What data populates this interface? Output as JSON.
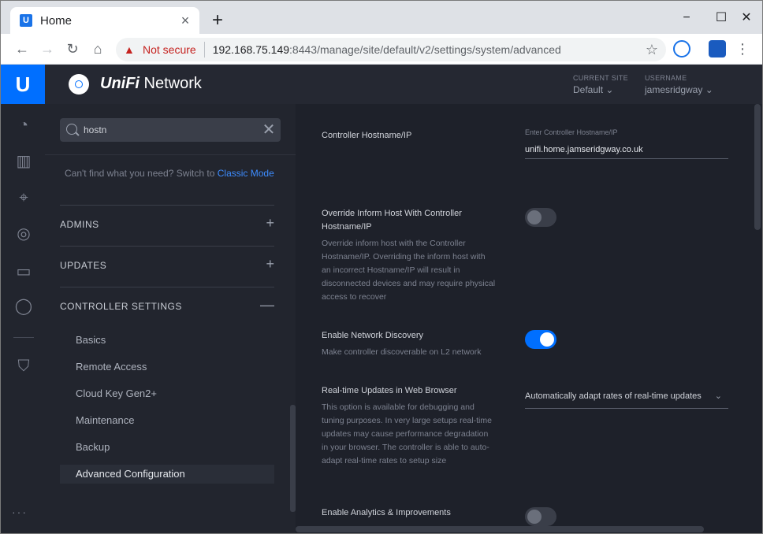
{
  "browser": {
    "tab_title": "Home",
    "tab_favicon": "U",
    "not_secure": "Not secure",
    "url_host": "192.168.75.149",
    "url_rest": ":8443/manage/site/default/v2/settings/system/advanced"
  },
  "header": {
    "brand_prefix": "UniFi",
    "brand_suffix": " Network",
    "current_site_label": "CURRENT SITE",
    "current_site_value": "Default",
    "username_label": "USERNAME",
    "username_value": "jamesridgway"
  },
  "sidebar": {
    "search_value": "hostn",
    "hint_text": "Can't find what you need? Switch to ",
    "hint_link": "Classic Mode",
    "sections": [
      {
        "label": "ADMINS",
        "toggle": "+"
      },
      {
        "label": "UPDATES",
        "toggle": "+"
      },
      {
        "label": "CONTROLLER SETTINGS",
        "toggle": "—"
      }
    ],
    "items": [
      {
        "label": "Basics"
      },
      {
        "label": "Remote Access"
      },
      {
        "label": "Cloud Key Gen2+"
      },
      {
        "label": "Maintenance"
      },
      {
        "label": "Backup"
      },
      {
        "label": "Advanced Configuration"
      }
    ]
  },
  "content": {
    "hostname_title": "Controller Hostname/IP",
    "hostname_field_label": "Enter Controller Hostname/IP",
    "hostname_value": "unifi.home.jamseridgway.co.uk",
    "override_title": "Override Inform Host With Controller Hostname/IP",
    "override_desc": "Override inform host with the Controller Hostname/IP. Overriding the inform host with an incorrect Hostname/IP will result in disconnected devices and may require physical access to recover",
    "override_on": false,
    "discovery_title": "Enable Network Discovery",
    "discovery_desc": "Make controller discoverable on L2 network",
    "discovery_on": true,
    "realtime_title": "Real-time Updates in Web Browser",
    "realtime_desc": "This option is available for debugging and tuning purposes. In very large setups real-time updates may cause performance degradation in your browser. The controller is able to auto-adapt real-time rates to setup size",
    "realtime_value": "Automatically adapt rates of real-time updates",
    "analytics_title": "Enable Analytics & Improvements",
    "analytics_on": false
  }
}
